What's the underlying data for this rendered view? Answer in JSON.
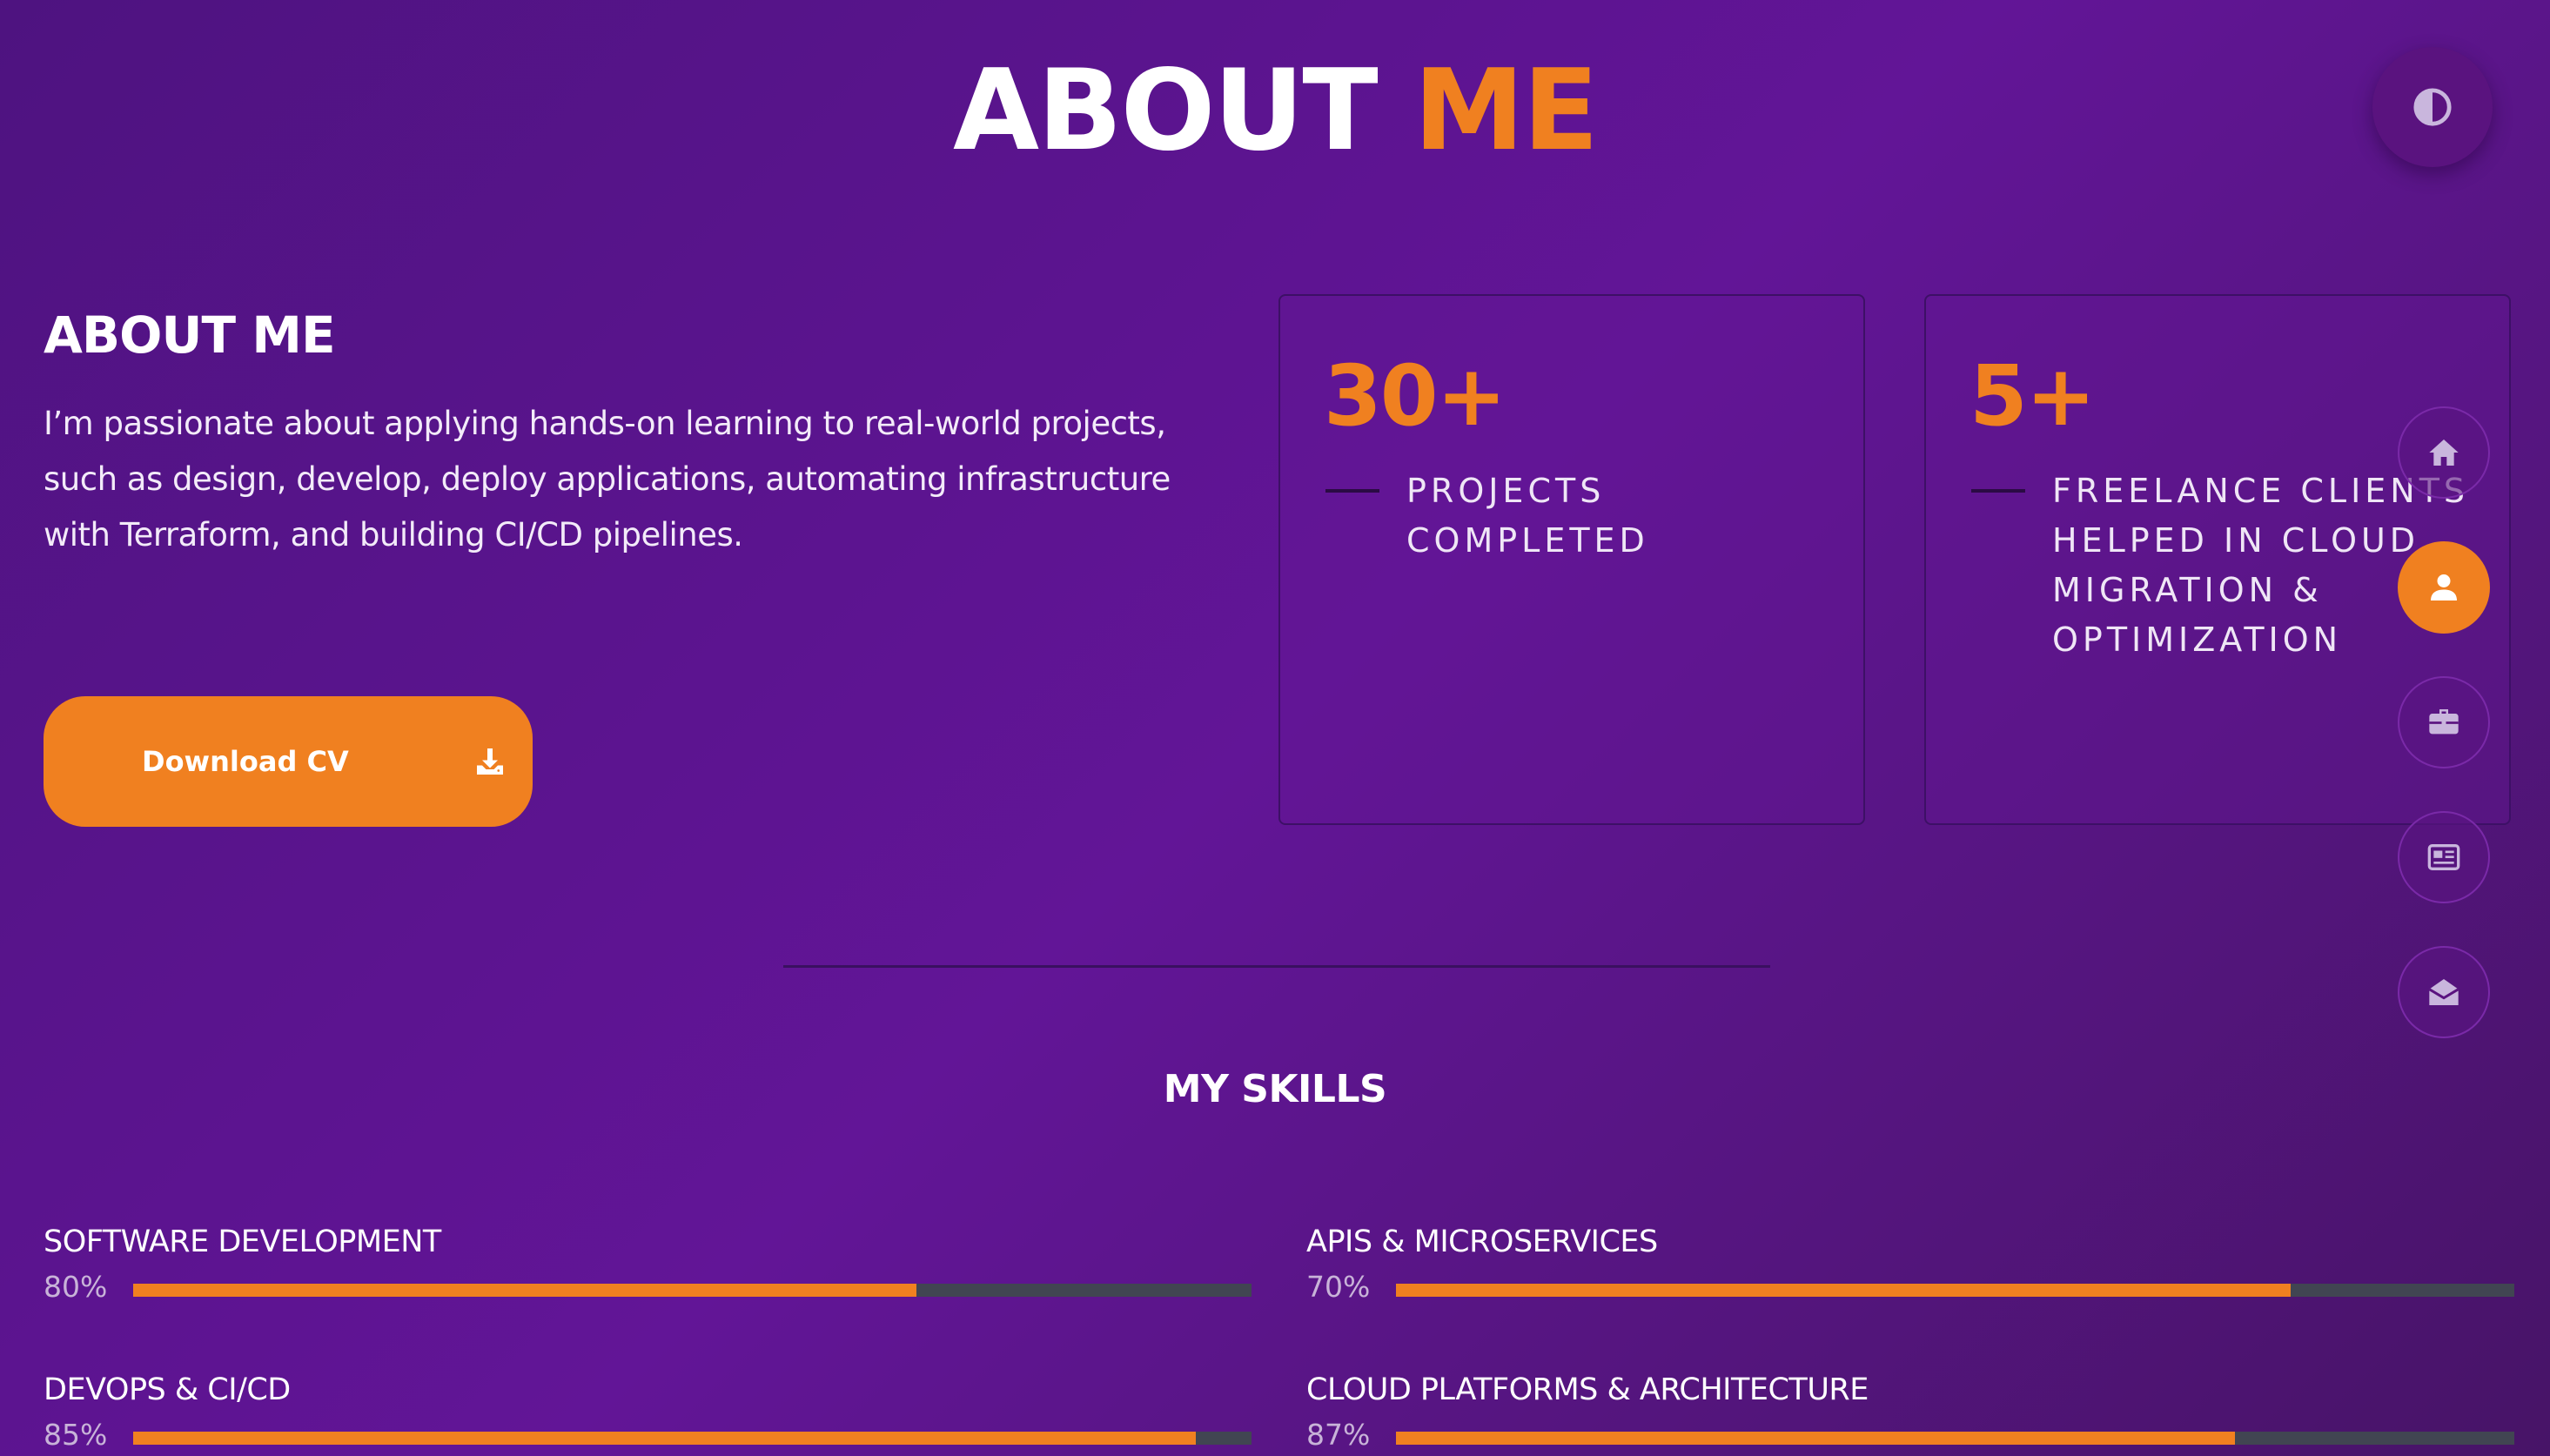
{
  "header": {
    "title_main": "ABOUT",
    "title_accent": "ME"
  },
  "theme_toggle": {
    "icon": "contrast-icon"
  },
  "about": {
    "heading": "ABOUT ME",
    "text": "I’m passionate about applying hands-on learning to real-world projects, such as design, develop, deploy applications, automating infrastructure with Terraform, and building CI/CD pipelines."
  },
  "download_button": {
    "label": "Download CV",
    "icon": "download-icon"
  },
  "stats": [
    {
      "number": "30+",
      "label": "PROJECTS COMPLETED"
    },
    {
      "number": "5+",
      "label": "FREELANCE CLIENTS HELPED IN CLOUD MIGRATION & OPTIMIZATION"
    }
  ],
  "side_nav": {
    "items": [
      {
        "icon": "home-icon",
        "active": false
      },
      {
        "icon": "user-icon",
        "active": true
      },
      {
        "icon": "briefcase-icon",
        "active": false
      },
      {
        "icon": "newspaper-icon",
        "active": false
      },
      {
        "icon": "envelope-open-icon",
        "active": false
      }
    ]
  },
  "skills": {
    "heading": "MY SKILLS",
    "items": [
      {
        "name": "SOFTWARE DEVELOPMENT",
        "percent_label": "80%",
        "fill": 0.7
      },
      {
        "name": "APIS & MICROSERVICES",
        "percent_label": "70%",
        "fill": 0.8
      },
      {
        "name": "DEVOPS & CI/CD",
        "percent_label": "85%",
        "fill": 0.95
      },
      {
        "name": "CLOUD PLATFORMS & ARCHITECTURE",
        "percent_label": "87%",
        "fill": 0.75
      }
    ]
  },
  "colors": {
    "accent": "#f08020",
    "background": "#5c1490",
    "track": "#414552"
  }
}
